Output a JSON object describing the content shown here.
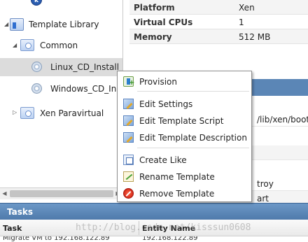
{
  "tree": {
    "items": [
      {
        "label": "Template Library",
        "icon": "template-library-icon",
        "expander": "◢"
      },
      {
        "label": "Common",
        "icon": "folder-icon",
        "expander": "◢"
      },
      {
        "label": "Linux_CD_Install",
        "icon": "cd-disc-icon"
      },
      {
        "label": "Windows_CD_Ins",
        "icon": "cd-disc-icon"
      },
      {
        "label": "Xen Paravirtual",
        "icon": "folder-icon",
        "expander": "▷"
      }
    ]
  },
  "properties": {
    "rows": [
      {
        "key": "Platform",
        "value": "Xen"
      },
      {
        "key": "Virtual CPUs",
        "value": "1"
      },
      {
        "key": "Memory",
        "value": "512 MB"
      }
    ],
    "fragments": [
      "/lib/xen/boot/hv",
      "troy",
      "art"
    ]
  },
  "context_menu": {
    "items": [
      {
        "label": "Provision",
        "icon": "provision-icon"
      },
      {
        "label": "Edit Settings",
        "icon": "edit-icon"
      },
      {
        "label": "Edit Template Script",
        "icon": "edit-script-icon"
      },
      {
        "label": "Edit Template Description",
        "icon": "edit-description-icon"
      },
      {
        "label": "Create Like",
        "icon": "create-like-icon"
      },
      {
        "label": "Rename Template",
        "icon": "rename-icon"
      },
      {
        "label": "Remove Template",
        "icon": "remove-icon"
      }
    ]
  },
  "tasks": {
    "title": "Tasks",
    "columns": [
      "Task",
      "Entity Name"
    ],
    "row_fragments": [
      "Migrate VM to 192.168.122.89",
      "192.168.122.89"
    ]
  },
  "watermark": "http://blog.csdn.net/kisssun0608",
  "colors": {
    "tasks_header": "#5b86b6",
    "selection": "#dcdcdc"
  }
}
